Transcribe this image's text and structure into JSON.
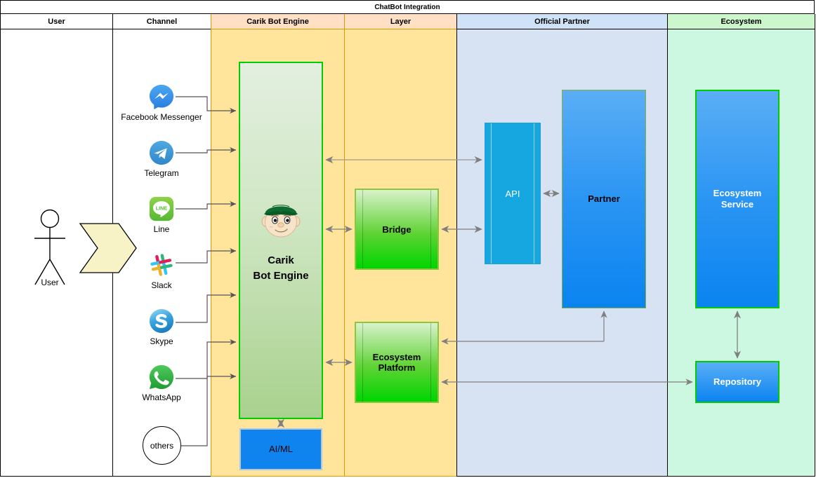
{
  "diagram": {
    "title": "ChatBot Integration",
    "type": "swimlane-architecture"
  },
  "lanes": [
    {
      "id": "user",
      "label": "User"
    },
    {
      "id": "channel",
      "label": "Channel"
    },
    {
      "id": "engine",
      "label": "Carik Bot Engine"
    },
    {
      "id": "layer",
      "label": "Layer"
    },
    {
      "id": "partner",
      "label": "Official Partner"
    },
    {
      "id": "eco",
      "label": "Ecosystem"
    }
  ],
  "actor": {
    "label": "User",
    "icon": "stick-figure-actor-icon",
    "flow_shape": "chevron-arrow-shape"
  },
  "channels": [
    {
      "id": "facebook",
      "label": "Facebook Messenger",
      "icon": "facebook-messenger-icon"
    },
    {
      "id": "telegram",
      "label": "Telegram",
      "icon": "telegram-icon"
    },
    {
      "id": "line",
      "label": "Line",
      "icon": "line-icon"
    },
    {
      "id": "slack",
      "label": "Slack",
      "icon": "slack-icon"
    },
    {
      "id": "skype",
      "label": "Skype",
      "icon": "skype-icon"
    },
    {
      "id": "whatsapp",
      "label": "WhatsApp",
      "icon": "whatsapp-icon"
    },
    {
      "id": "others",
      "label": "others",
      "icon": "circle-node-icon"
    }
  ],
  "nodes": {
    "carik": {
      "label": "Carik\nBot Engine",
      "line1": "Carik",
      "line2": "Bot Engine",
      "icon": "carik-mascot-icon"
    },
    "aiml": {
      "label": "AI/ML"
    },
    "bridge": {
      "label": "Bridge"
    },
    "ecoplatform": {
      "line1": "Ecosystem",
      "line2": "Platform"
    },
    "api": {
      "label": "API"
    },
    "partner": {
      "label": "Partner"
    },
    "ecoservice": {
      "line1": "Ecosystem",
      "line2": "Service"
    },
    "repository": {
      "label": "Repository"
    }
  },
  "colors": {
    "lane_engine_header": "#ffe0c4",
    "lane_engine_body": "#ffe49b",
    "lane_partner_header": "#cfe2f8",
    "lane_partner_body": "#d7e2f3",
    "lane_eco_header": "#ccf7cd",
    "lane_eco_body": "#ccf7e0",
    "green_border": "#00cc00",
    "green_fill": "#00d500",
    "blue_fill": "#0f84ef",
    "api_fill": "#16a6e0",
    "chevron_fill": "#f5f2c8",
    "connector": "#7f7f7f"
  }
}
